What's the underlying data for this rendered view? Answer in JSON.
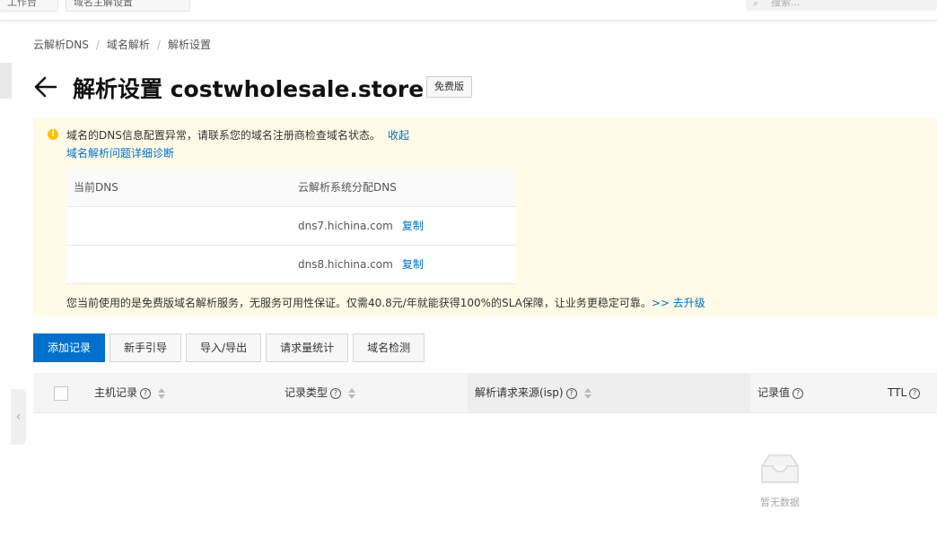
{
  "topbar": {
    "btn1": "工作台",
    "btn2": "域名主解设置",
    "search_placeholder": "搜索..."
  },
  "breadcrumb": [
    "云解析DNS",
    "域名解析",
    "解析设置"
  ],
  "title": "解析设置 costwholesale.store",
  "plan_badge": "免费版",
  "alert": {
    "message": "域名的DNS信息配置异常，请联系您的域名注册商检查域名状态。",
    "collapse": "收起",
    "diagnose_link": "域名解析问题详细诊断",
    "dns_table": {
      "col_current": "当前DNS",
      "col_assigned": "云解析系统分配DNS",
      "rows": [
        {
          "current": "",
          "assigned": "dns7.hichina.com",
          "copy": "复制"
        },
        {
          "current": "",
          "assigned": "dns8.hichina.com",
          "copy": "复制"
        }
      ]
    },
    "footer": "您当前使用的是免费版域名解析服务，无服务可用性保证。仅需40.8元/年就能获得100%的SLA保障，让业务更稳定可靠。",
    "upgrade": ">> 去升级"
  },
  "toolbar": {
    "add": "添加记录",
    "guide": "新手引导",
    "import_export": "导入/导出",
    "stats": "请求量统计",
    "check": "域名检测"
  },
  "records": {
    "columns": {
      "host": "主机记录",
      "type": "记录类型",
      "isp": "解析请求来源(isp)",
      "value": "记录值",
      "ttl": "TTL"
    },
    "empty": "暂无数据"
  },
  "colors": {
    "accent": "#0070cc",
    "alert_bg": "#fffbe6",
    "warn": "#ffc107"
  }
}
